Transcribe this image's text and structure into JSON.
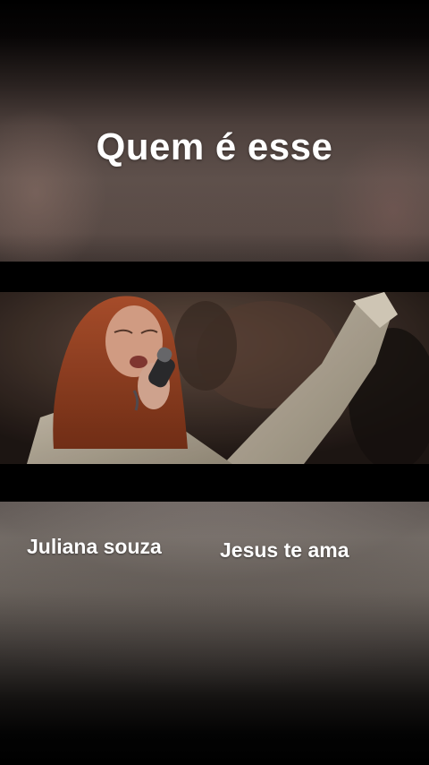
{
  "overlay": {
    "title": "Quem é esse",
    "caption_left": "Juliana souza",
    "caption_right": "Jesus te ama"
  },
  "video": {
    "subject": "singer-with-microphone"
  }
}
